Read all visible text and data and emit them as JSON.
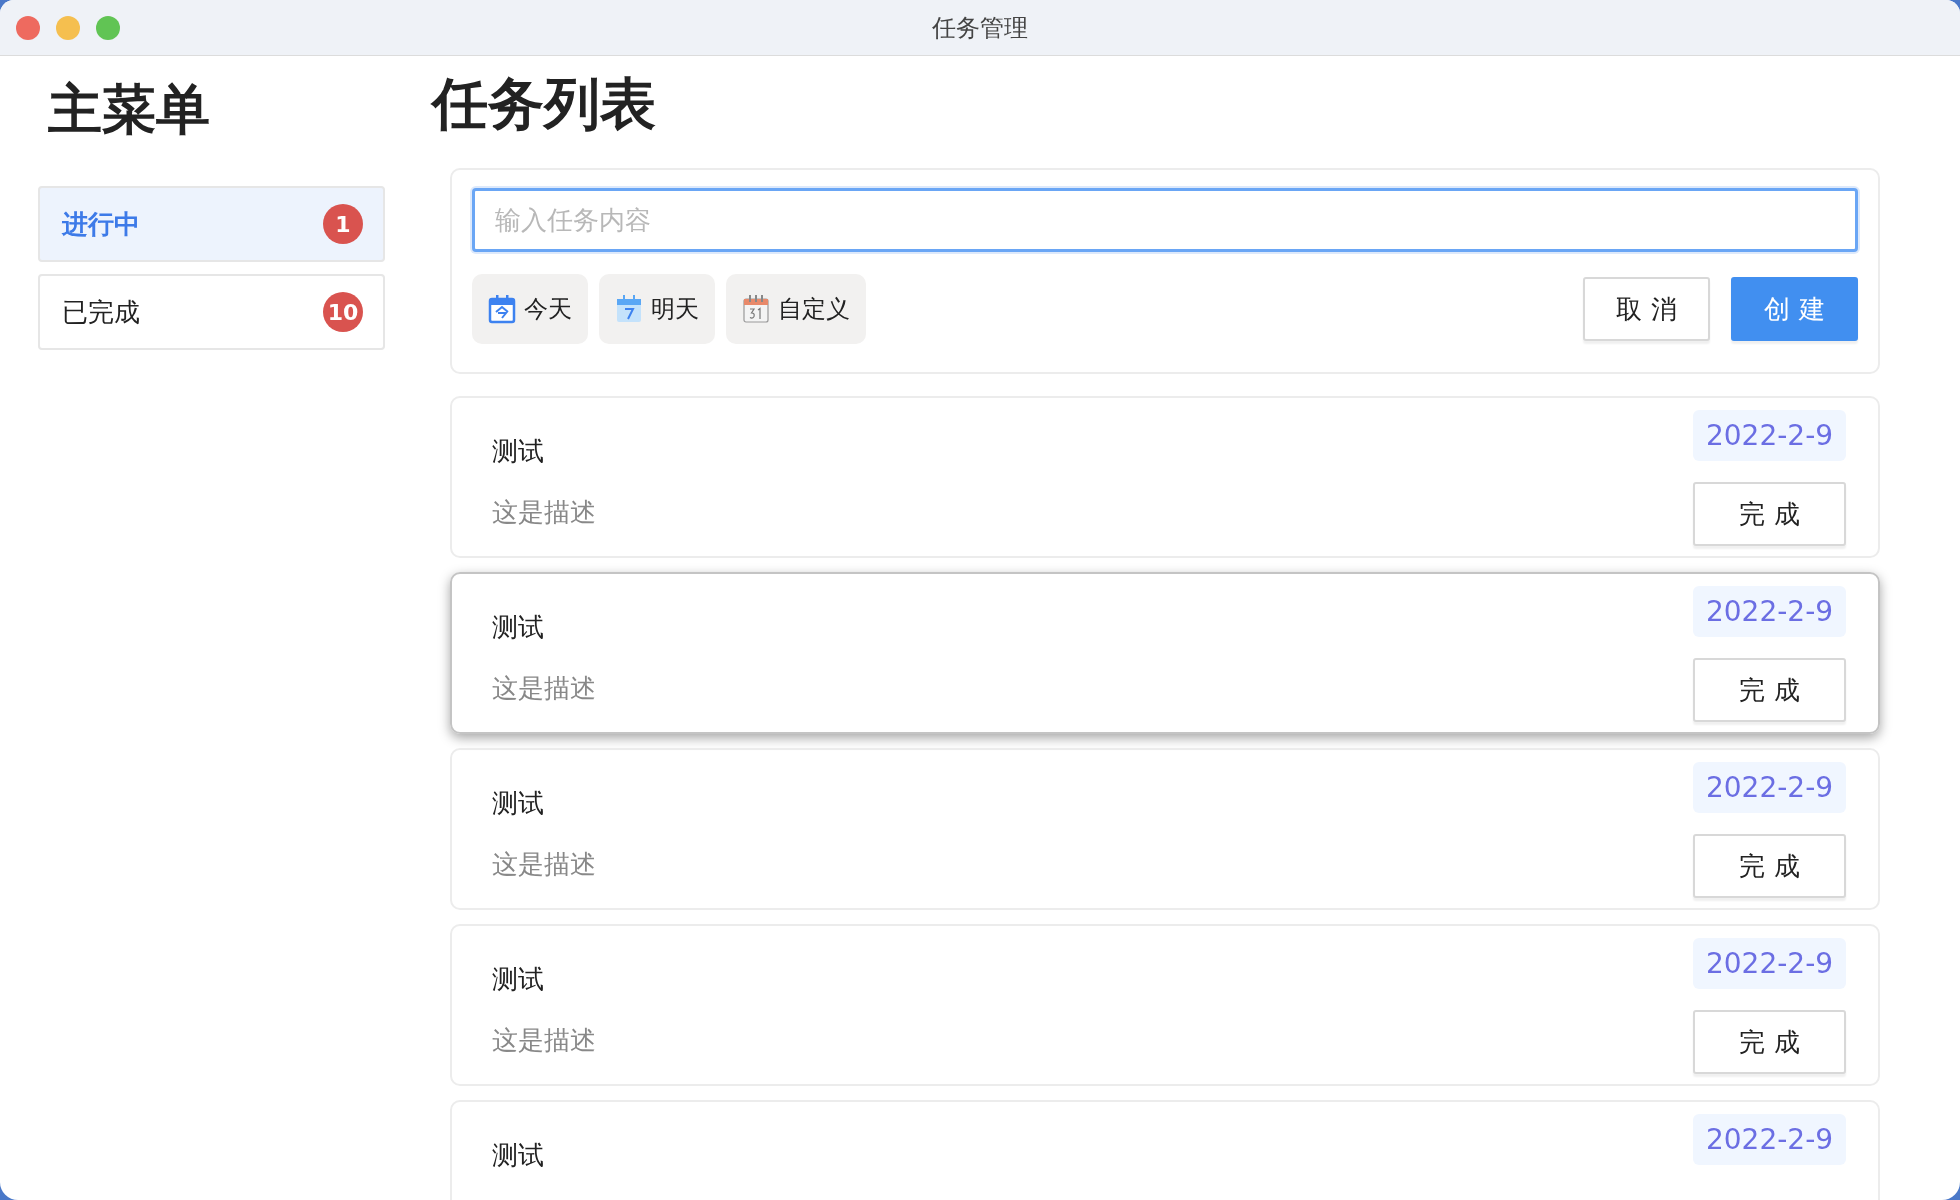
{
  "window": {
    "title": "任务管理"
  },
  "sidebar": {
    "title": "主菜单",
    "items": [
      {
        "label": "进行中",
        "count": "1",
        "selected": true
      },
      {
        "label": "已完成",
        "count": "10",
        "selected": false
      }
    ]
  },
  "main": {
    "title": "任务列表"
  },
  "new_task": {
    "input": {
      "placeholder": "输入任务内容"
    },
    "date_options": [
      {
        "kind": "today",
        "label": "今天"
      },
      {
        "kind": "tomorrow",
        "label": "明天"
      },
      {
        "kind": "custom",
        "label": "自定义"
      }
    ],
    "cancel_button": "取 消",
    "create_button": "创 建"
  },
  "tasks": [
    {
      "title": "测试",
      "description": "这是描述",
      "date": "2022-2-9",
      "action": "完 成",
      "raised": false
    },
    {
      "title": "测试",
      "description": "这是描述",
      "date": "2022-2-9",
      "action": "完 成",
      "raised": true
    },
    {
      "title": "测试",
      "description": "这是描述",
      "date": "2022-2-9",
      "action": "完 成",
      "raised": false
    },
    {
      "title": "测试",
      "description": "这是描述",
      "date": "2022-2-9",
      "action": "完 成",
      "raised": false
    },
    {
      "title": "测试",
      "date": "2022-2-9",
      "raised": false
    }
  ]
}
